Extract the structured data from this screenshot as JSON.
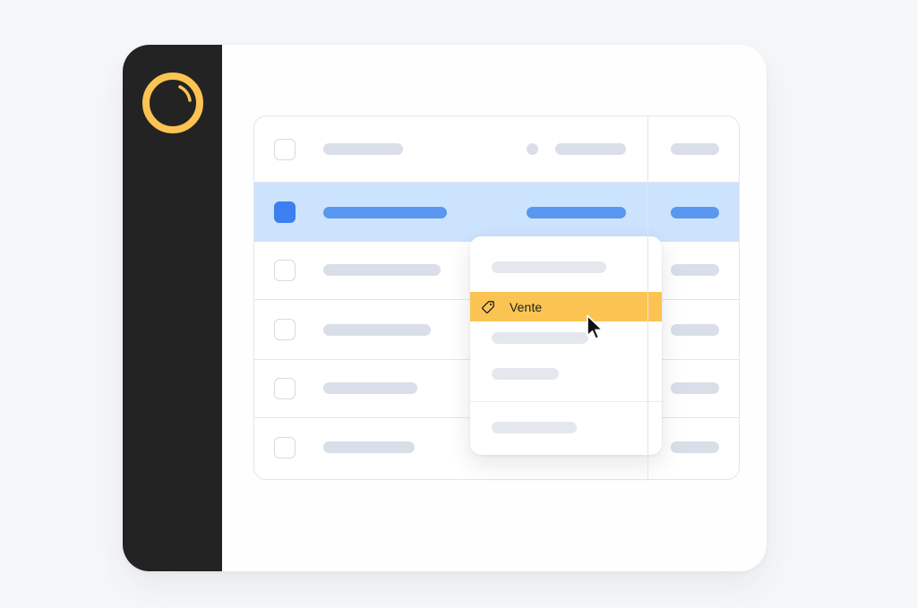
{
  "dropdown": {
    "active_item": {
      "label": "Vente",
      "icon": "tag-icon"
    }
  },
  "colors": {
    "sidebar": "#242324",
    "logo_ring": "#fbc452",
    "selected_row": "#cce3fd",
    "checkbox_checked": "#3b7ff0",
    "highlight_item": "#fbc452"
  }
}
